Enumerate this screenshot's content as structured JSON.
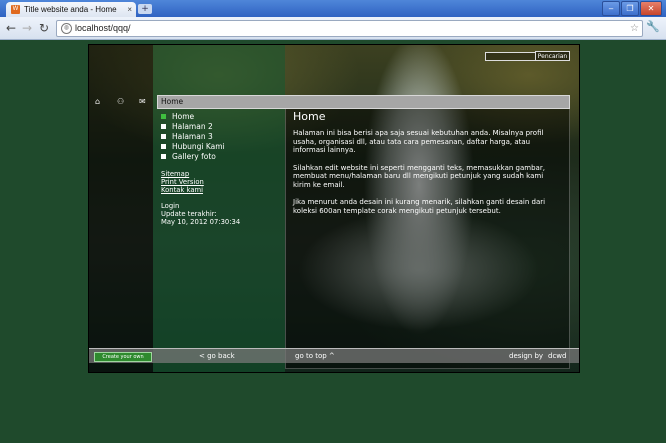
{
  "browser": {
    "tab_title": "Title website anda - Home",
    "tab_close": "×",
    "new_tab": "+",
    "url": "localhost/qqq/",
    "back": "←",
    "forward": "→",
    "reload": "↻",
    "star": "☆",
    "wrench": "🔧",
    "win_min": "‒",
    "win_max": "❐",
    "win_close": "✕",
    "favicon": "W"
  },
  "site": {
    "search": {
      "value": "",
      "button_label": "Pencarian"
    },
    "top_icons": [
      "home-icon",
      "sitemap-icon",
      "mail-icon"
    ],
    "icon_glyphs": {
      "home": "⌂",
      "sitemap": "⚇",
      "mail": "✉"
    },
    "breadcrumb": "Home",
    "menu": [
      {
        "label": "Home",
        "active": true
      },
      {
        "label": "Halaman 2",
        "active": false
      },
      {
        "label": "Halaman 3",
        "active": false
      },
      {
        "label": "Hubungi Kami",
        "active": false
      },
      {
        "label": "Gallery foto",
        "active": false
      }
    ],
    "links": {
      "sitemap": "Sitemap",
      "print": "Print Version",
      "contact": "Kontak kami"
    },
    "meta": {
      "login": "Login",
      "updated_label": "Update terakhir:",
      "updated_value": "May 10, 2012 07:30:34"
    },
    "page_title": "Home",
    "content": [
      "Halaman ini bisa berisi apa saja sesuai kebutuhan anda. Misalnya profil usaha, organisasi dll, atau tata cara pemesanan, daftar harga, atau informasi lainnya.",
      "Silahkan edit website ini seperti mengganti teks, memasukkan gambar, membuat menu/halaman baru dll mengikuti petunjuk yang sudah kami kirim ke email.",
      "Jika menurut anda desain ini kurang menarik, silahkan ganti desain dari koleksi 600an template corak mengikuti petunjuk tersebut."
    ],
    "footer": {
      "logo_text": "Create your own website",
      "back": "< go back",
      "top": "go to top ^",
      "design_by": "design by",
      "designer": "dcwd"
    }
  },
  "colors": {
    "background": "#1f4a2c",
    "active_bullet": "#3fbf3f",
    "designer_link": "#7fd0ff"
  }
}
